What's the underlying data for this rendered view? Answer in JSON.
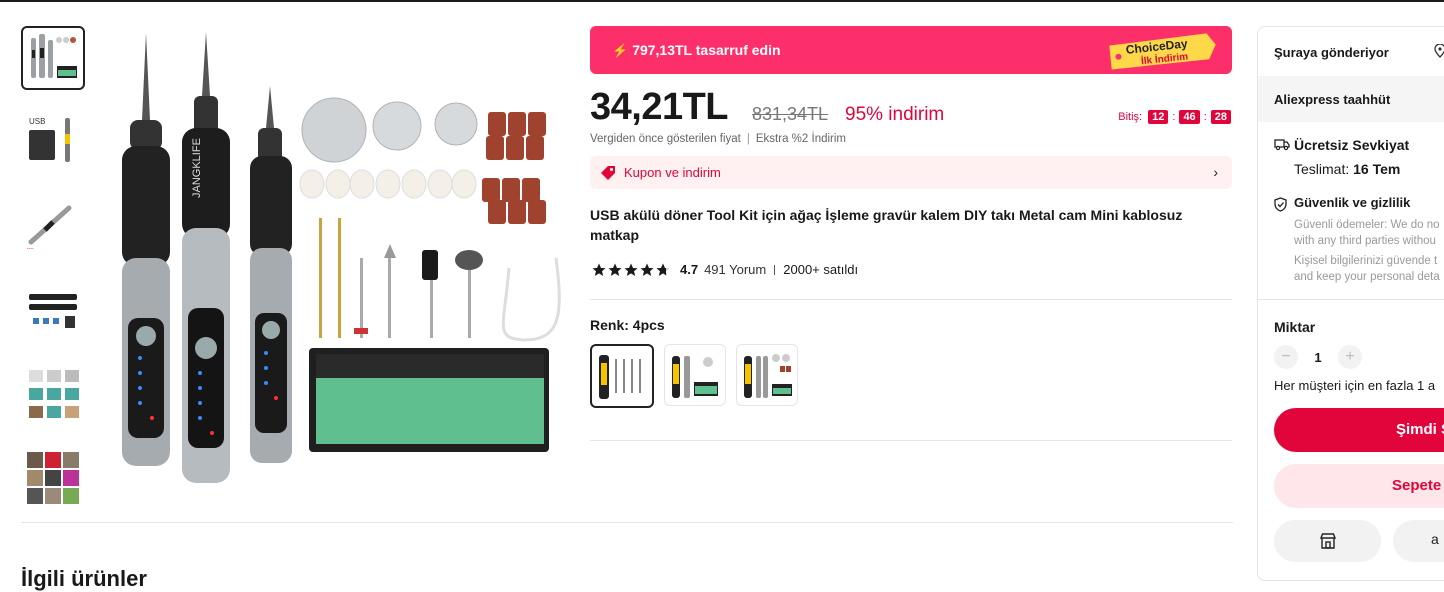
{
  "banner": {
    "savings_text": "797,13TL tasarruf edin",
    "choice_line1": "ChoiceDay",
    "choice_line2": "İlk İndirim",
    "bg_color": "#fd2f6a"
  },
  "price": {
    "current": "34,21TL",
    "original": "831,34TL",
    "discount": "95% indirim",
    "timer_label": "Bitiş:",
    "timer_h": "12",
    "timer_m": "46",
    "timer_s": "28",
    "note_left": "Vergiden önce gösterilen fiyat",
    "note_right": "Ekstra %2 İndirim"
  },
  "coupon": {
    "label": "Kupon ve indirim",
    "icon": "tag-icon",
    "chevron": "›"
  },
  "product": {
    "title": "USB akülü döner Tool Kit için ağaç İşleme gravür kalem DIY takı Metal cam Mini kablosuz matkap",
    "rating": "4.7",
    "stars": 4.7,
    "reviews": "491 Yorum",
    "sold": "2000+ satıldı",
    "color_label": "Renk: 4pcs",
    "thumbnails": [
      "product-thumb-1",
      "product-thumb-2",
      "product-thumb-3",
      "product-thumb-4",
      "product-thumb-5",
      "product-thumb-6"
    ],
    "thumb_usb_label": "USB"
  },
  "related": {
    "title": "İlgili ürünler"
  },
  "panel": {
    "ship_to": "Şuraya gönderiyor",
    "commitment": "Aliexpress taahhüt",
    "free_shipping": "Ücretsiz Sevkiyat",
    "delivery_label": "Teslimat:",
    "delivery_value": "16 Tem",
    "security_title": "Güvenlik ve gizlilik",
    "sec_line1": "Güvenli ödemeler: We do no",
    "sec_line2": "with any third parties withou",
    "sec_line3": "Kişisel bilgilerinizi güvende t",
    "sec_line4": "and keep your personal deta",
    "qty_label": "Miktar",
    "qty_value": "1",
    "qty_minus": "−",
    "qty_plus": "+",
    "qty_limit": "Her müşteri için en fazla 1 a",
    "buy_now": "Şimdi S",
    "add_to_cart": "Sepete",
    "share_glyph": "a"
  },
  "colors": {
    "accent": "#e1053b",
    "banner": "#fd2f6a",
    "coupon_bg": "#fff0f1"
  }
}
